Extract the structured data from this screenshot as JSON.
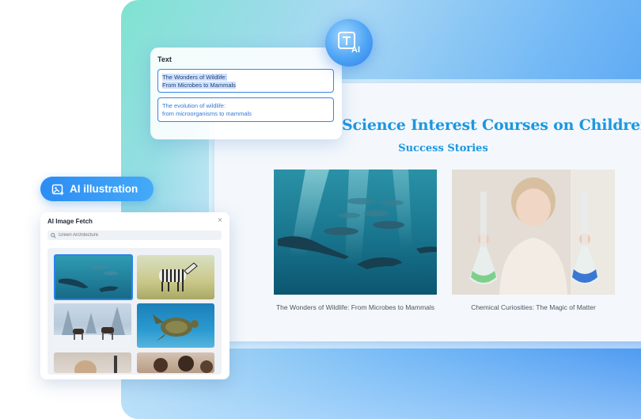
{
  "text_panel": {
    "title": "Text",
    "options": [
      {
        "line1": "The Wonders of Wildlife:",
        "line2": "From Microbes to Mammals"
      },
      {
        "line1": "The evolution of wildlife:",
        "line2": "from microorganisms to mammals"
      }
    ]
  },
  "slide": {
    "title": "Science Interest Courses on Children",
    "subtitle": "Success Stories",
    "captions": [
      "The Wonders of Wildlife: From Microbes to Mammals",
      "Chemical Curiosities: The Magic of Matter"
    ]
  },
  "ai_pill": {
    "label": "AI illustration"
  },
  "image_fetch": {
    "title": "AI Image Fetch",
    "search_placeholder": "Green Architecture",
    "close_symbol": "×"
  },
  "icons": {
    "ai_text": "text-ai-icon",
    "illustration": "image-sparkle-icon",
    "search": "search-icon",
    "close": "close-icon"
  },
  "colors": {
    "accent_blue": "#1c97e0",
    "selection_border": "#2a84ee",
    "pill_gradient_start": "#2c8cf4",
    "pill_gradient_end": "#44aaf8"
  }
}
